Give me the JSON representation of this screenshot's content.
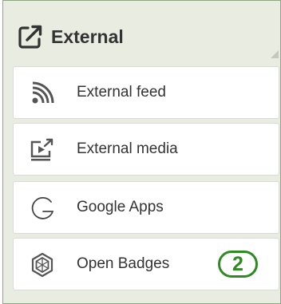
{
  "panel": {
    "title": "External",
    "title_icon": "external-link-icon",
    "items": [
      {
        "label": "External feed",
        "icon": "rss-feed-icon"
      },
      {
        "label": "External media",
        "icon": "external-media-icon"
      },
      {
        "label": "Google Apps",
        "icon": "google-g-icon"
      },
      {
        "label": "Open Badges",
        "icon": "open-badges-icon",
        "callout": "2"
      }
    ]
  },
  "colors": {
    "panel_background": "#e8ece1",
    "panel_border": "#8fa583",
    "callout": "#2f8a24"
  }
}
